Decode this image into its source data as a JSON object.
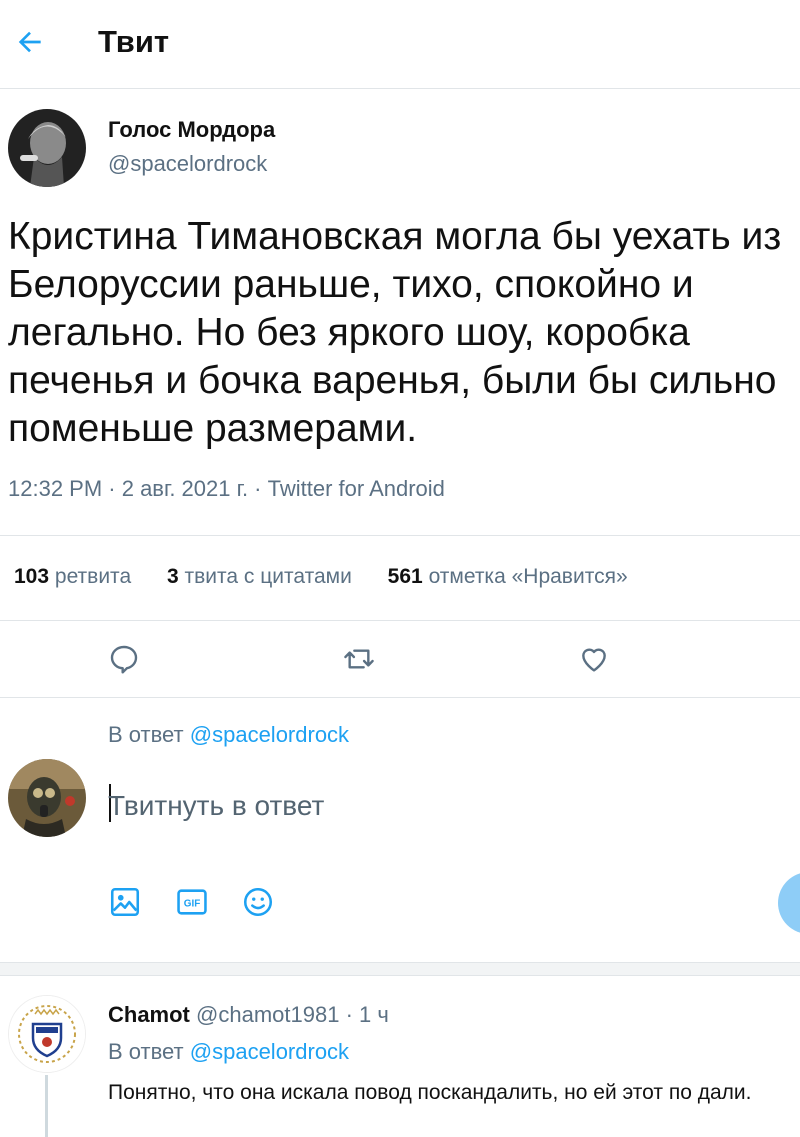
{
  "header": {
    "title": "Твит"
  },
  "tweet": {
    "author_name": "Голос Мордора",
    "author_handle": "@spacelordrock",
    "text": "Кристина Тимановская могла бы уехать из Белоруссии раньше, тихо, спокойно и легально. Но без яркого шоу, коробка печенья и бочка варенья, были бы сильно поменьше размерами.",
    "meta": "12:32 PM · 2 авг. 2021 г. · Twitter for Android",
    "stats": [
      {
        "count": "103",
        "label": "ретвита"
      },
      {
        "count": "3",
        "label": "твита с цитатами"
      },
      {
        "count": "561",
        "label": "отметка «Нравится»"
      }
    ]
  },
  "compose": {
    "reply_prefix": "В ответ",
    "reply_handle": "@spacelordrock",
    "placeholder": "Твитнуть в ответ",
    "gif_label": "GIF"
  },
  "reply": {
    "author_name": "Chamot",
    "author_handle": "@chamot1981",
    "time": "· 1 ч",
    "reply_prefix": "В ответ",
    "reply_handle": "@spacelordrock",
    "text": "Понятно, что она искала повод поскандалить, но ей этот по дали."
  },
  "colors": {
    "accent": "#1da1f2",
    "secondary_text": "#5b7083",
    "send_button": "#8ecdf7"
  },
  "icons": [
    "back-arrow-icon",
    "reply-icon",
    "retweet-icon",
    "like-icon",
    "image-icon",
    "gif-icon",
    "emoji-icon"
  ]
}
